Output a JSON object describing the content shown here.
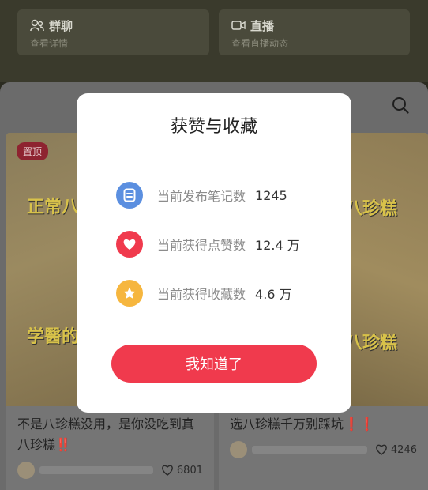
{
  "top_cards": [
    {
      "title": "群聊",
      "subtitle": "查看详情",
      "icon": "group-icon"
    },
    {
      "title": "直播",
      "subtitle": "查看直播动态",
      "icon": "live-icon"
    }
  ],
  "feed": {
    "left": {
      "badge": "置顶",
      "img_text_top": "正常八",
      "img_text_bottom": "学醫的",
      "title": "不是八珍糕没用，是你没吃到真八珍糕‼️",
      "likes": "6801"
    },
    "right": {
      "img_text_top": "八珍糕",
      "img_text_bottom": "八珍糕",
      "title": "选八珍糕千万别踩坑❗❗",
      "likes": "4246"
    }
  },
  "modal": {
    "title": "获赞与收藏",
    "stats": [
      {
        "label": "当前发布笔记数",
        "value": "1245",
        "icon": "note-icon",
        "color": "#5b8fe0"
      },
      {
        "label": "当前获得点赞数",
        "value": "12.4 万",
        "icon": "heart-icon",
        "color": "#f03a4d"
      },
      {
        "label": "当前获得收藏数",
        "value": "4.6 万",
        "icon": "star-icon",
        "color": "#f6b63e"
      }
    ],
    "button_label": "我知道了"
  }
}
